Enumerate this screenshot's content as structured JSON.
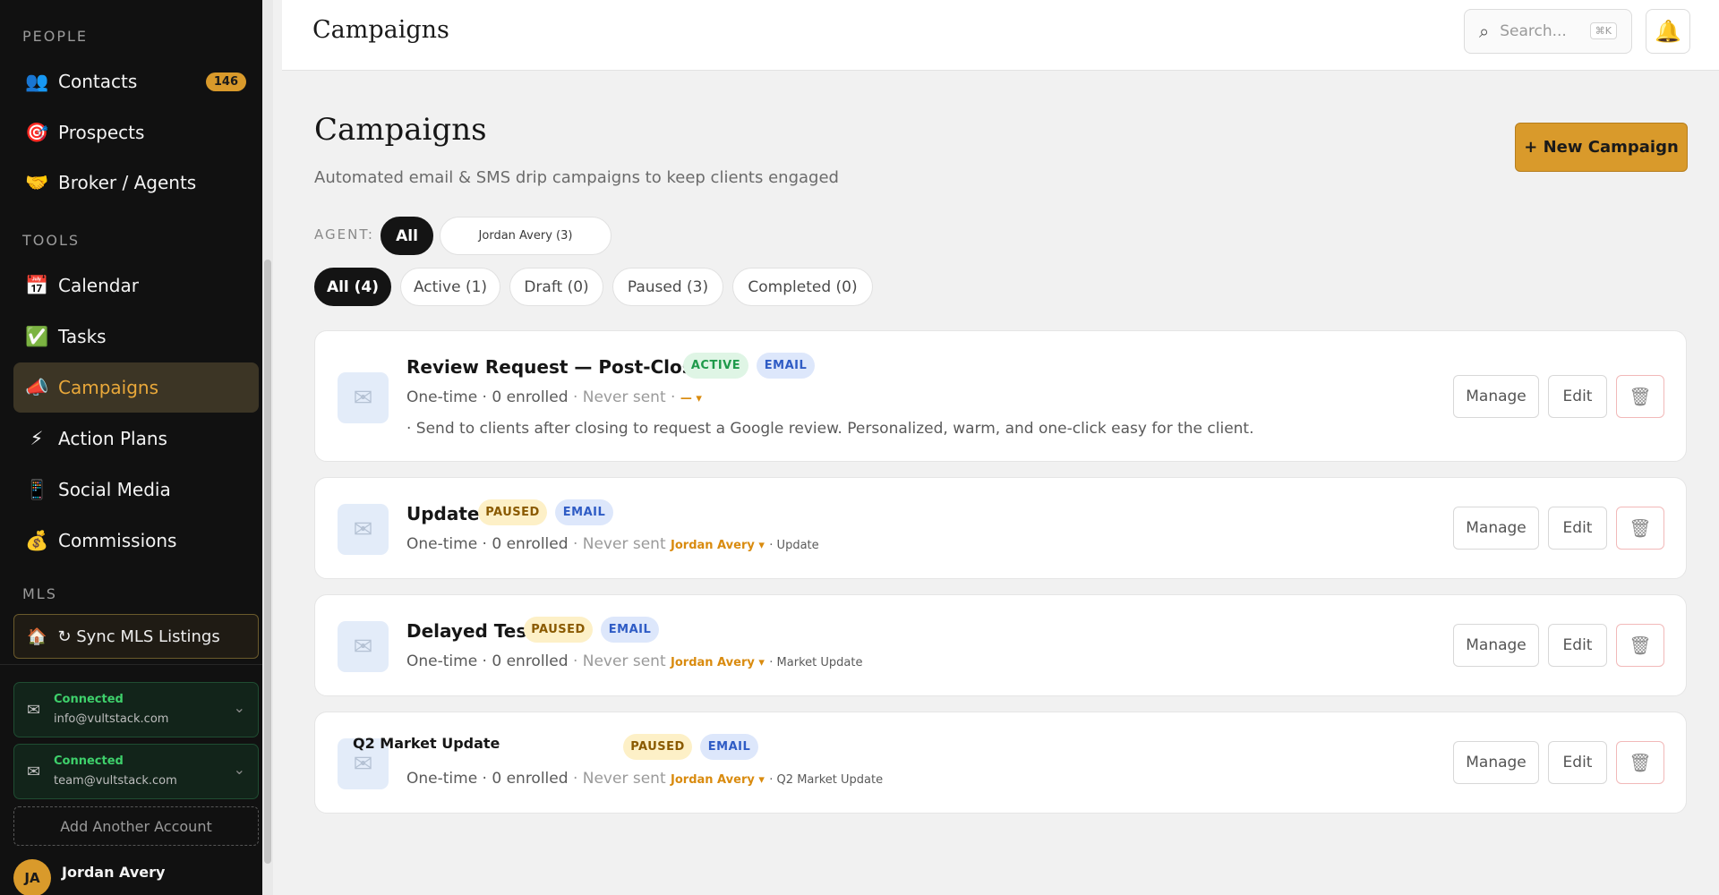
{
  "sidebar": {
    "people_label": "PEOPLE",
    "tools_label": "TOOLS",
    "mls_label": "MLS",
    "people": [
      {
        "icon": "👥",
        "label": "Contacts",
        "badge": "146"
      },
      {
        "icon": "🎯",
        "label": "Prospects"
      },
      {
        "icon": "🤝",
        "label": "Broker / Agents"
      }
    ],
    "tools": [
      {
        "icon": "📅",
        "label": "Calendar"
      },
      {
        "icon": "✅",
        "label": "Tasks"
      },
      {
        "icon": "📣",
        "label": "Campaigns"
      },
      {
        "icon": "⚡",
        "label": "Action Plans"
      },
      {
        "icon": "📱",
        "label": "Social Media"
      },
      {
        "icon": "💰",
        "label": "Commissions"
      }
    ],
    "sync": {
      "icon": "🏠",
      "label": "↻ Sync MLS Listings"
    },
    "accounts": [
      {
        "status": "Connected",
        "email": "info@vultstack.com"
      },
      {
        "status": "Connected",
        "email": "team@vultstack.com"
      }
    ],
    "add_account": "Add Another Account",
    "user": {
      "initials": "JA",
      "name": "Jordan Avery"
    }
  },
  "topbar": {
    "title": "Campaigns",
    "search_placeholder": "Search...",
    "search_shortcut": "⌘K"
  },
  "main": {
    "title": "Campaigns",
    "subtitle": "Automated email & SMS drip campaigns to keep clients engaged",
    "new_button": "+ New Campaign",
    "agent_label": "AGENT:",
    "agent_filters": [
      "All",
      "Jordan Avery (3)"
    ],
    "status_filters": [
      "All (4)",
      "Active (1)",
      "Draft (0)",
      "Paused (3)",
      "Completed (0)"
    ],
    "meta_prefix": "One-time · 0 enrolled",
    "never_sent": "· Never sent",
    "manage_label": "Manage",
    "edit_label": "Edit",
    "delete_icon": "🗑",
    "campaigns": [
      {
        "title": "Review Request — Post-Closing",
        "status": "ACTIVE",
        "channel": "EMAIL",
        "agent": "— ▾",
        "type": "",
        "description": "· Send to clients after closing to request a Google review. Personalized, warm, and one-click easy for the client."
      },
      {
        "title": "Update",
        "status": "PAUSED",
        "channel": "EMAIL",
        "agent": "Jordan Avery ▾",
        "type": "· Update"
      },
      {
        "title": "Delayed Test",
        "status": "PAUSED",
        "channel": "EMAIL",
        "agent": "Jordan Avery ▾",
        "type": "· Market Update"
      },
      {
        "title": "Q2 Market Update",
        "status": "PAUSED",
        "channel": "EMAIL",
        "agent": "Jordan Avery ▾",
        "type": "· Q2 Market Update"
      }
    ]
  },
  "colors": {
    "accent": "#d99a2b",
    "sidebar_bg": "#111111",
    "active_tag": "#1f9a4b",
    "paused_tag": "#8a5a00",
    "email_tag": "#2f5cc5"
  }
}
